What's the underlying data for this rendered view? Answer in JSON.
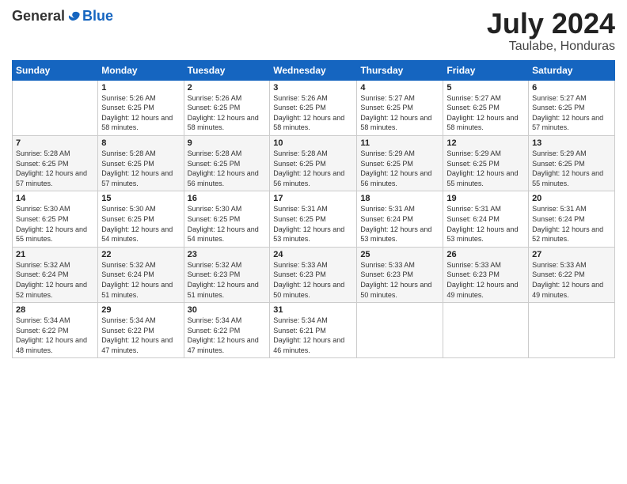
{
  "header": {
    "logo_general": "General",
    "logo_blue": "Blue",
    "month_title": "July 2024",
    "location": "Taulabe, Honduras"
  },
  "calendar": {
    "days_of_week": [
      "Sunday",
      "Monday",
      "Tuesday",
      "Wednesday",
      "Thursday",
      "Friday",
      "Saturday"
    ],
    "weeks": [
      [
        {
          "day": "",
          "sunrise": "",
          "sunset": "",
          "daylight": ""
        },
        {
          "day": "1",
          "sunrise": "Sunrise: 5:26 AM",
          "sunset": "Sunset: 6:25 PM",
          "daylight": "Daylight: 12 hours and 58 minutes."
        },
        {
          "day": "2",
          "sunrise": "Sunrise: 5:26 AM",
          "sunset": "Sunset: 6:25 PM",
          "daylight": "Daylight: 12 hours and 58 minutes."
        },
        {
          "day": "3",
          "sunrise": "Sunrise: 5:26 AM",
          "sunset": "Sunset: 6:25 PM",
          "daylight": "Daylight: 12 hours and 58 minutes."
        },
        {
          "day": "4",
          "sunrise": "Sunrise: 5:27 AM",
          "sunset": "Sunset: 6:25 PM",
          "daylight": "Daylight: 12 hours and 58 minutes."
        },
        {
          "day": "5",
          "sunrise": "Sunrise: 5:27 AM",
          "sunset": "Sunset: 6:25 PM",
          "daylight": "Daylight: 12 hours and 58 minutes."
        },
        {
          "day": "6",
          "sunrise": "Sunrise: 5:27 AM",
          "sunset": "Sunset: 6:25 PM",
          "daylight": "Daylight: 12 hours and 57 minutes."
        }
      ],
      [
        {
          "day": "7",
          "sunrise": "Sunrise: 5:28 AM",
          "sunset": "Sunset: 6:25 PM",
          "daylight": "Daylight: 12 hours and 57 minutes."
        },
        {
          "day": "8",
          "sunrise": "Sunrise: 5:28 AM",
          "sunset": "Sunset: 6:25 PM",
          "daylight": "Daylight: 12 hours and 57 minutes."
        },
        {
          "day": "9",
          "sunrise": "Sunrise: 5:28 AM",
          "sunset": "Sunset: 6:25 PM",
          "daylight": "Daylight: 12 hours and 56 minutes."
        },
        {
          "day": "10",
          "sunrise": "Sunrise: 5:28 AM",
          "sunset": "Sunset: 6:25 PM",
          "daylight": "Daylight: 12 hours and 56 minutes."
        },
        {
          "day": "11",
          "sunrise": "Sunrise: 5:29 AM",
          "sunset": "Sunset: 6:25 PM",
          "daylight": "Daylight: 12 hours and 56 minutes."
        },
        {
          "day": "12",
          "sunrise": "Sunrise: 5:29 AM",
          "sunset": "Sunset: 6:25 PM",
          "daylight": "Daylight: 12 hours and 55 minutes."
        },
        {
          "day": "13",
          "sunrise": "Sunrise: 5:29 AM",
          "sunset": "Sunset: 6:25 PM",
          "daylight": "Daylight: 12 hours and 55 minutes."
        }
      ],
      [
        {
          "day": "14",
          "sunrise": "Sunrise: 5:30 AM",
          "sunset": "Sunset: 6:25 PM",
          "daylight": "Daylight: 12 hours and 55 minutes."
        },
        {
          "day": "15",
          "sunrise": "Sunrise: 5:30 AM",
          "sunset": "Sunset: 6:25 PM",
          "daylight": "Daylight: 12 hours and 54 minutes."
        },
        {
          "day": "16",
          "sunrise": "Sunrise: 5:30 AM",
          "sunset": "Sunset: 6:25 PM",
          "daylight": "Daylight: 12 hours and 54 minutes."
        },
        {
          "day": "17",
          "sunrise": "Sunrise: 5:31 AM",
          "sunset": "Sunset: 6:25 PM",
          "daylight": "Daylight: 12 hours and 53 minutes."
        },
        {
          "day": "18",
          "sunrise": "Sunrise: 5:31 AM",
          "sunset": "Sunset: 6:24 PM",
          "daylight": "Daylight: 12 hours and 53 minutes."
        },
        {
          "day": "19",
          "sunrise": "Sunrise: 5:31 AM",
          "sunset": "Sunset: 6:24 PM",
          "daylight": "Daylight: 12 hours and 53 minutes."
        },
        {
          "day": "20",
          "sunrise": "Sunrise: 5:31 AM",
          "sunset": "Sunset: 6:24 PM",
          "daylight": "Daylight: 12 hours and 52 minutes."
        }
      ],
      [
        {
          "day": "21",
          "sunrise": "Sunrise: 5:32 AM",
          "sunset": "Sunset: 6:24 PM",
          "daylight": "Daylight: 12 hours and 52 minutes."
        },
        {
          "day": "22",
          "sunrise": "Sunrise: 5:32 AM",
          "sunset": "Sunset: 6:24 PM",
          "daylight": "Daylight: 12 hours and 51 minutes."
        },
        {
          "day": "23",
          "sunrise": "Sunrise: 5:32 AM",
          "sunset": "Sunset: 6:23 PM",
          "daylight": "Daylight: 12 hours and 51 minutes."
        },
        {
          "day": "24",
          "sunrise": "Sunrise: 5:33 AM",
          "sunset": "Sunset: 6:23 PM",
          "daylight": "Daylight: 12 hours and 50 minutes."
        },
        {
          "day": "25",
          "sunrise": "Sunrise: 5:33 AM",
          "sunset": "Sunset: 6:23 PM",
          "daylight": "Daylight: 12 hours and 50 minutes."
        },
        {
          "day": "26",
          "sunrise": "Sunrise: 5:33 AM",
          "sunset": "Sunset: 6:23 PM",
          "daylight": "Daylight: 12 hours and 49 minutes."
        },
        {
          "day": "27",
          "sunrise": "Sunrise: 5:33 AM",
          "sunset": "Sunset: 6:22 PM",
          "daylight": "Daylight: 12 hours and 49 minutes."
        }
      ],
      [
        {
          "day": "28",
          "sunrise": "Sunrise: 5:34 AM",
          "sunset": "Sunset: 6:22 PM",
          "daylight": "Daylight: 12 hours and 48 minutes."
        },
        {
          "day": "29",
          "sunrise": "Sunrise: 5:34 AM",
          "sunset": "Sunset: 6:22 PM",
          "daylight": "Daylight: 12 hours and 47 minutes."
        },
        {
          "day": "30",
          "sunrise": "Sunrise: 5:34 AM",
          "sunset": "Sunset: 6:22 PM",
          "daylight": "Daylight: 12 hours and 47 minutes."
        },
        {
          "day": "31",
          "sunrise": "Sunrise: 5:34 AM",
          "sunset": "Sunset: 6:21 PM",
          "daylight": "Daylight: 12 hours and 46 minutes."
        },
        {
          "day": "",
          "sunrise": "",
          "sunset": "",
          "daylight": ""
        },
        {
          "day": "",
          "sunrise": "",
          "sunset": "",
          "daylight": ""
        },
        {
          "day": "",
          "sunrise": "",
          "sunset": "",
          "daylight": ""
        }
      ]
    ]
  }
}
